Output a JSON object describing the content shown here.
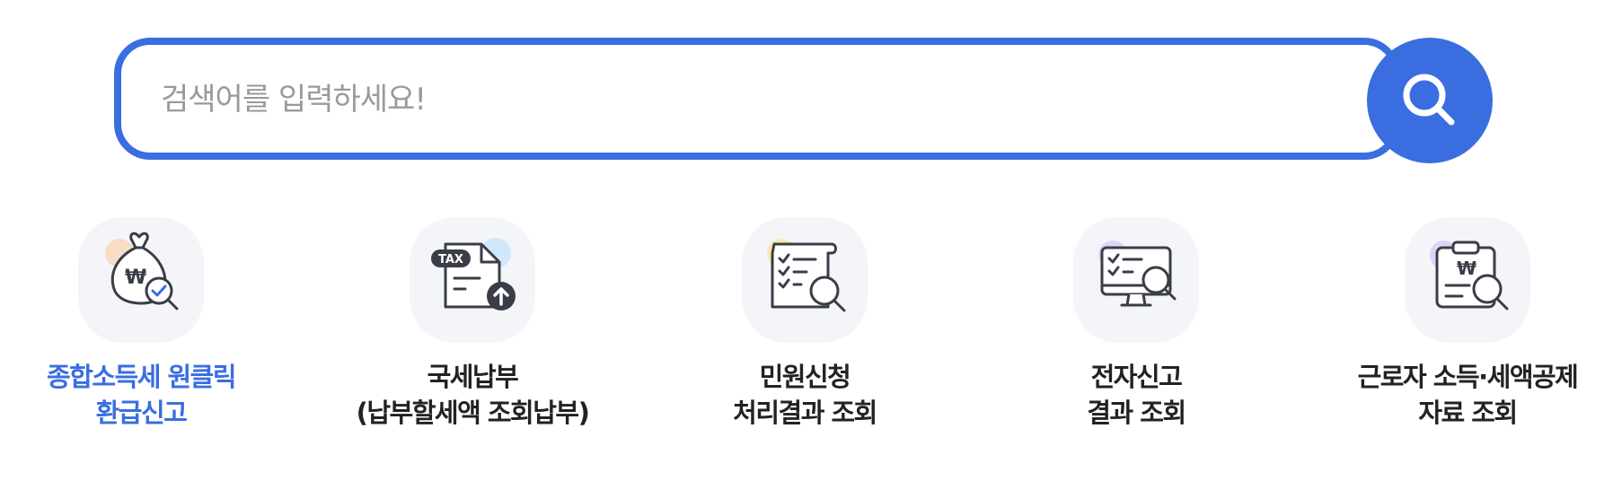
{
  "search": {
    "placeholder": "검색어를 입력하세요!",
    "button_icon": "search-icon",
    "accent_color": "#3a6ee0"
  },
  "quick_menu": [
    {
      "line1": "종합소득세 원클릭",
      "line2": "환급신고",
      "icon": "money-bag-check-icon",
      "active": true
    },
    {
      "line1": "국세납부",
      "line2": "(납부할세액 조회납부)",
      "icon": "tax-document-upload-icon",
      "active": false
    },
    {
      "line1": "민원신청",
      "line2": "처리결과 조회",
      "icon": "checklist-search-icon",
      "active": false
    },
    {
      "line1": "전자신고",
      "line2": "결과 조회",
      "icon": "monitor-search-icon",
      "active": false
    },
    {
      "line1": "근로자 소득·세액공제",
      "line2": "자료 조회",
      "icon": "clipboard-won-search-icon",
      "active": false
    }
  ]
}
